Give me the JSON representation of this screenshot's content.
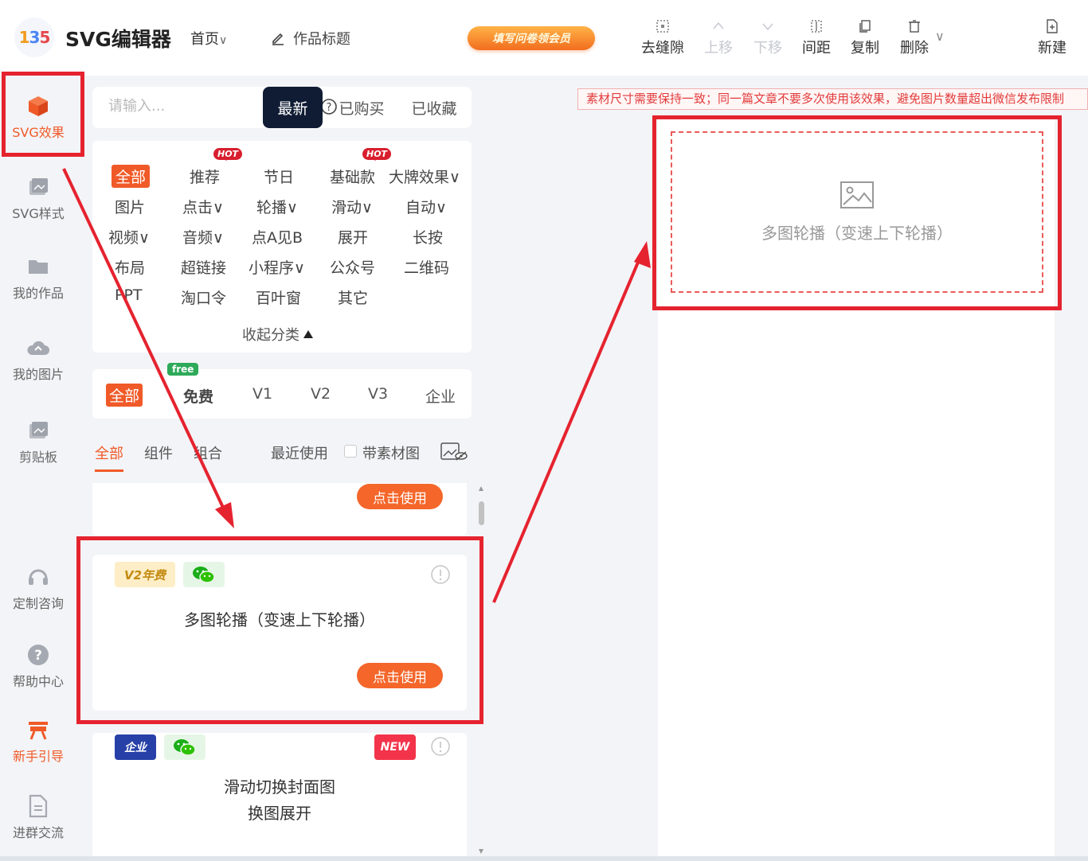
{
  "header": {
    "logo_text": "135",
    "app_title": "SVG编辑器",
    "home_menu": "首页",
    "work_title": "作品标题",
    "survey_button": "填写问卷领会员",
    "tools": [
      {
        "label": "去缝隙",
        "icon": "gap-remove-icon",
        "disabled": false
      },
      {
        "label": "上移",
        "icon": "chevron-up-icon",
        "disabled": true
      },
      {
        "label": "下移",
        "icon": "chevron-down-icon",
        "disabled": true
      },
      {
        "label": "间距",
        "icon": "spacing-icon",
        "disabled": false
      },
      {
        "label": "复制",
        "icon": "copy-icon",
        "disabled": false
      },
      {
        "label": "删除",
        "icon": "trash-icon",
        "disabled": false
      },
      {
        "label": "新建",
        "icon": "new-file-icon",
        "disabled": false
      }
    ]
  },
  "rail": {
    "items": [
      {
        "label": "SVG效果",
        "icon": "cube-icon",
        "active": true
      },
      {
        "label": "SVG样式",
        "icon": "image-frame-icon",
        "active": false
      },
      {
        "label": "我的作品",
        "icon": "folder-icon",
        "active": false
      },
      {
        "label": "我的图片",
        "icon": "cloud-upload-icon",
        "active": false
      },
      {
        "label": "剪贴板",
        "icon": "clipboard-icon",
        "active": false
      },
      {
        "label": "定制咨询",
        "icon": "headset-icon",
        "active": false
      },
      {
        "label": "帮助中心",
        "icon": "question-icon",
        "active": false
      },
      {
        "label": "新手引导",
        "icon": "guide-icon",
        "active": false
      },
      {
        "label": "进群交流",
        "icon": "document-icon",
        "active": false
      }
    ]
  },
  "search": {
    "placeholder": "请输入...",
    "tabs": [
      "最新",
      "已购买",
      "已收藏"
    ],
    "active_tab": "最新"
  },
  "categories": {
    "rows": [
      [
        "全部",
        "推荐",
        "节日",
        "基础款",
        "大牌效果∨"
      ],
      [
        "图片",
        "点击∨",
        "轮播∨",
        "滑动∨",
        "自动∨"
      ],
      [
        "视频∨",
        "音频∨",
        "点A见B",
        "展开",
        "长按"
      ],
      [
        "布局",
        "超链接",
        "小程序∨",
        "公众号",
        "二维码"
      ],
      [
        "PPT",
        "淘口令",
        "百叶窗",
        "其它"
      ]
    ],
    "hot_badge": "HOT",
    "collapse_label": "收起分类"
  },
  "versions": {
    "items": [
      "全部",
      "免费",
      "V1",
      "V2",
      "V3",
      "企业"
    ],
    "free_badge": "free"
  },
  "filters": {
    "tabs": [
      "全部",
      "组件",
      "组合"
    ],
    "recent": "最近使用",
    "with_material": "带素材图"
  },
  "cards": [
    {
      "title": "",
      "use_label": "点击使用"
    },
    {
      "title": "多图轮播（变速上下轮播）",
      "badge1": "V2年费",
      "use_label": "点击使用"
    },
    {
      "title_line1": "滑动切换封面图",
      "title_line2": "换图展开",
      "badge1": "企业",
      "badge_new": "NEW"
    }
  ],
  "canvas": {
    "notice": "素材尺寸需要保持一致；同一篇文章不要多次使用该效果，避免图片数量超出微信发布限制",
    "placeholder_label": "多图轮播（变速上下轮播）"
  },
  "colors": {
    "accent": "#f05a28",
    "annotation_red": "#e5232f",
    "dark_tab": "#101c34"
  }
}
